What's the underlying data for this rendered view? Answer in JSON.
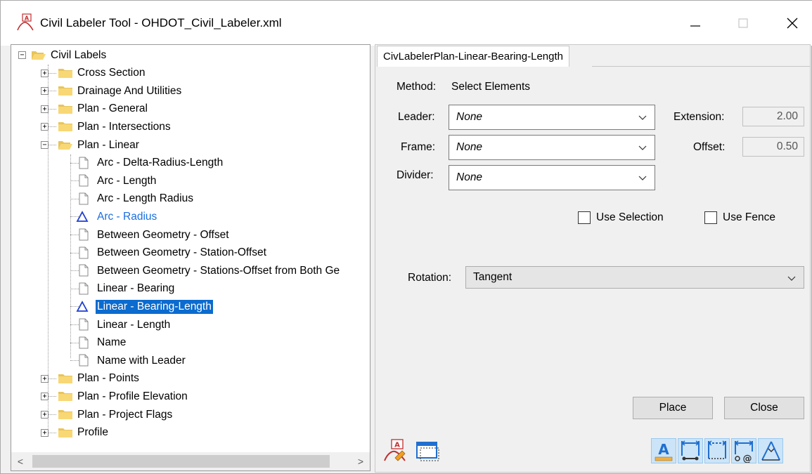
{
  "window": {
    "title": "Civil Labeler Tool - OHDOT_Civil_Labeler.xml"
  },
  "tree": {
    "root": "Civil Labels",
    "folders_before": [
      "Cross Section",
      "Drainage And Utilities",
      "Plan - General",
      "Plan - Intersections"
    ],
    "open_folder": "Plan - Linear",
    "children": [
      {
        "label": "Arc - Delta-Radius-Length",
        "icon": "document-icon",
        "style": "normal"
      },
      {
        "label": "Arc - Length",
        "icon": "document-icon",
        "style": "normal"
      },
      {
        "label": "Arc - Length Radius",
        "icon": "document-icon",
        "style": "normal"
      },
      {
        "label": "Arc - Radius",
        "icon": "triangle-icon",
        "style": "blue"
      },
      {
        "label": "Between Geometry - Offset",
        "icon": "document-icon",
        "style": "normal"
      },
      {
        "label": "Between Geometry - Station-Offset",
        "icon": "document-icon",
        "style": "normal"
      },
      {
        "label": "Between Geometry - Stations-Offset from Both Ge",
        "icon": "document-icon",
        "style": "normal"
      },
      {
        "label": "Linear - Bearing",
        "icon": "document-icon",
        "style": "normal"
      },
      {
        "label": "Linear - Bearing-Length",
        "icon": "triangle-icon",
        "style": "selected"
      },
      {
        "label": "Linear - Length",
        "icon": "document-icon",
        "style": "normal"
      },
      {
        "label": "Name",
        "icon": "document-icon",
        "style": "normal"
      },
      {
        "label": "Name with Leader",
        "icon": "document-icon",
        "style": "normal"
      }
    ],
    "folders_after": [
      "Plan - Points",
      "Plan - Profile Elevation",
      "Plan - Project Flags",
      "Profile"
    ]
  },
  "panel": {
    "tab_label": "CivLabelerPlan-Linear-Bearing-Length",
    "method_label": "Method:",
    "method_value": "Select Elements",
    "leader_label": "Leader:",
    "leader_value": "None",
    "frame_label": "Frame:",
    "frame_value": "None",
    "divider_label": "Divider:",
    "divider_value": "None",
    "extension_label": "Extension:",
    "extension_value": "2.00",
    "offset_label": "Offset:",
    "offset_value": "0.50",
    "use_selection_label": "Use Selection",
    "use_fence_label": "Use Fence",
    "use_selection_checked": false,
    "use_fence_checked": false,
    "rotation_label": "Rotation:",
    "rotation_value": "Tangent",
    "place_label": "Place",
    "close_label": "Close"
  },
  "colors": {
    "selection": "#0b6bcf",
    "link_blue": "#1a6fe0",
    "folder": "#f8d775",
    "icon_blue": "#1f6fd0"
  }
}
